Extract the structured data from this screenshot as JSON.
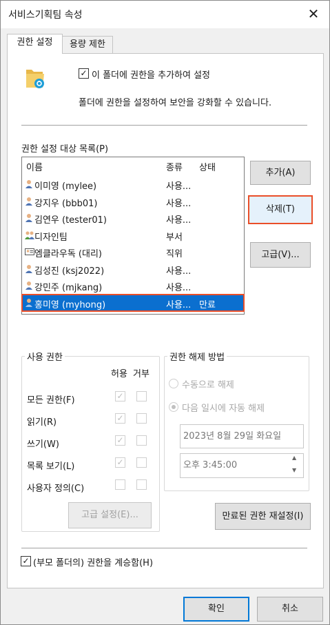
{
  "window": {
    "title": "서비스기획팀 속성",
    "close_glyph": "✕"
  },
  "tabs": [
    {
      "label": "권한 설정",
      "active": true
    },
    {
      "label": "용량 제한",
      "active": false
    }
  ],
  "header": {
    "add_permission_checkbox": {
      "label": "이 폴더에 권한을 추가하여 설정",
      "checked": true
    },
    "description": "폴더에 권한을 설정하여 보안을 강화할 수 있습니다."
  },
  "permission_list": {
    "label": "권한 설정 대상 목록(P)",
    "columns": [
      "이름",
      "종류",
      "상태"
    ],
    "rows": [
      {
        "name": "이미영 (mylee)",
        "type": "사용...",
        "status": "",
        "icon": "user-icon"
      },
      {
        "name": "강지우 (bbb01)",
        "type": "사용...",
        "status": "",
        "icon": "user-icon"
      },
      {
        "name": "김연우 (tester01)",
        "type": "사용...",
        "status": "",
        "icon": "user-icon"
      },
      {
        "name": "디자인팀",
        "type": "부서",
        "status": "",
        "icon": "department-icon"
      },
      {
        "name": "엠클라우독 (대리)",
        "type": "직위",
        "status": "",
        "icon": "position-icon"
      },
      {
        "name": "김성진 (ksj2022)",
        "type": "사용...",
        "status": "",
        "icon": "user-icon"
      },
      {
        "name": "강민주 (mjkang)",
        "type": "사용...",
        "status": "",
        "icon": "user-icon"
      },
      {
        "name": "홍미영 (myhong)",
        "type": "사용...",
        "status": "만료",
        "icon": "user-icon",
        "selected": true
      }
    ]
  },
  "side_buttons": {
    "add": "추가(A)",
    "delete": "삭제(T)",
    "advanced": "고급(V)..."
  },
  "usage_permissions": {
    "title": "사용 권한",
    "allow_header": "허용",
    "deny_header": "거부",
    "items": [
      {
        "label": "모든 권한(F)",
        "allow": true,
        "deny": false
      },
      {
        "label": "읽기(R)",
        "allow": true,
        "deny": false
      },
      {
        "label": "쓰기(W)",
        "allow": true,
        "deny": false
      },
      {
        "label": "목록 보기(L)",
        "allow": true,
        "deny": false
      },
      {
        "label": "사용자 정의(C)",
        "allow": false,
        "deny": false
      }
    ],
    "advanced_button": "고급 설정(E)..."
  },
  "release_method": {
    "title": "권한 해제 방법",
    "manual_label": "수동으로 해제",
    "auto_label": "다음 일시에 자동 해제",
    "auto_selected": true,
    "date_value": "2023년   8월 29일 화요일",
    "time_value": "오후   3:45:00",
    "spin_up": "▲",
    "spin_down": "▼",
    "reset_button": "만료된 권한 재설정(I)"
  },
  "inherit_checkbox": {
    "label": "(부모 폴더의) 권한을 계승함(H)",
    "checked": true
  },
  "footer": {
    "ok": "확인",
    "cancel": "취소"
  },
  "colors": {
    "selection": "#0b6fcf",
    "highlight": "#ea4e28",
    "default_button": "#0078d7"
  }
}
